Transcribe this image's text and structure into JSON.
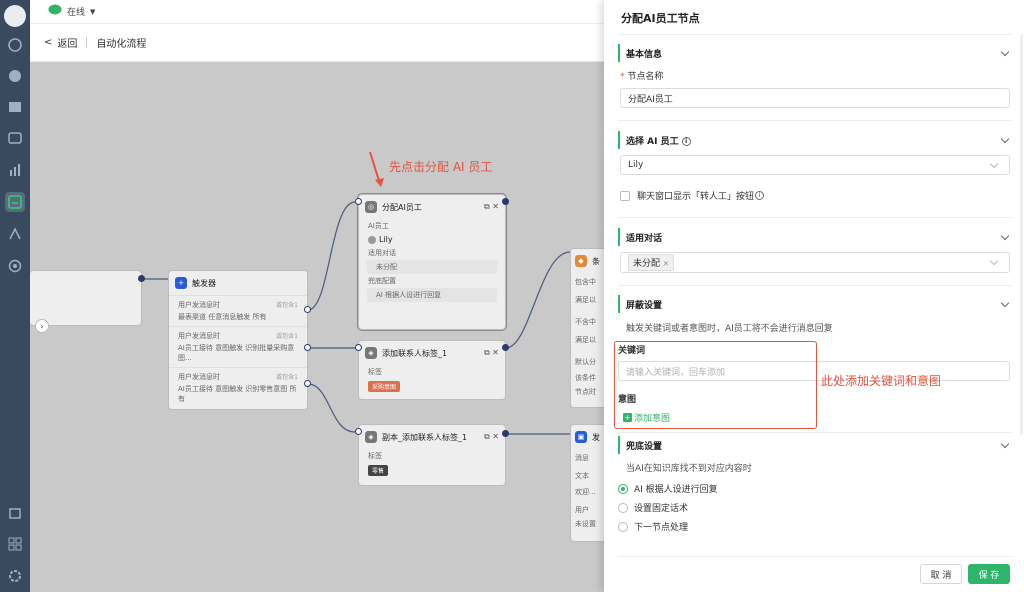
{
  "topbar": {
    "status": "在线"
  },
  "subbar": {
    "back": "返回",
    "title": "自动化流程"
  },
  "canvas": {
    "trigger": {
      "title": "触发器",
      "rows": [
        {
          "label": "用户发消息时",
          "badge": "或包含1",
          "desc": "最表渠道 任意消息触发 所有"
        },
        {
          "label": "用户发消息时",
          "badge": "或包含1",
          "desc": "AI员工接待 意图触发 识别批量采购意图..."
        },
        {
          "label": "用户发消息时",
          "badge": "或包含1",
          "desc": "AI员工接待 意图触发 识别零售意图 所有"
        }
      ]
    },
    "assign": {
      "title": "分配AI员工",
      "f1": "AI员工",
      "employee": "Lily",
      "f2": "适用对话",
      "unassigned": "未分配",
      "f3": "兜底配置",
      "fallback": "AI 根据人设进行回复"
    },
    "tag1": {
      "title": "添加联系人标签_1",
      "field": "标签",
      "tag": "采购意图"
    },
    "tag2": {
      "title": "副本_添加联系人标签_1",
      "field": "标签",
      "tag": "零售"
    },
    "cond": {
      "title": "条",
      "r1": "包含中",
      "r2": "满足以",
      "r3": "不含中",
      "r4": "满足以",
      "r5": "默认分",
      "r6": "该条件",
      "r7": "节点时"
    },
    "reply": {
      "title": "发",
      "r1": "消息",
      "r2": "文本",
      "r3": "欢迎...",
      "r4": "用户",
      "r5": "未设置"
    },
    "annotation": "先点击分配 AI 员工"
  },
  "panel": {
    "title": "分配AI员工节点",
    "basic": {
      "head": "基本信息",
      "name_label": "节点名称",
      "name_value": "分配AI员工"
    },
    "select": {
      "head": "选择 AI 员工",
      "employee": "Lily",
      "checkbox_label": "聊天窗口显示「转人工」按钮"
    },
    "dialog": {
      "head": "适用对话",
      "tag": "未分配"
    },
    "shield": {
      "head": "屏蔽设置",
      "desc": "触发关键词或者意图时，AI员工将不会进行消息回复",
      "kw_label": "关键词",
      "kw_placeholder": "请输入关键词，回车添加",
      "intent_label": "意图",
      "add_intent": "添加意图"
    },
    "fallback": {
      "head": "兜底设置",
      "desc": "当AI在知识库找不到对应内容时",
      "opt1": "AI 根据人设进行回复",
      "opt2": "设置固定话术",
      "opt3": "下一节点处理"
    },
    "cancel": "取 消",
    "save": "保 存",
    "annotation": "此处添加关键词和意图"
  },
  "colors": {
    "accent": "#2fb56a",
    "annotation": "#e8523c",
    "rail": "#3a4a5e"
  }
}
